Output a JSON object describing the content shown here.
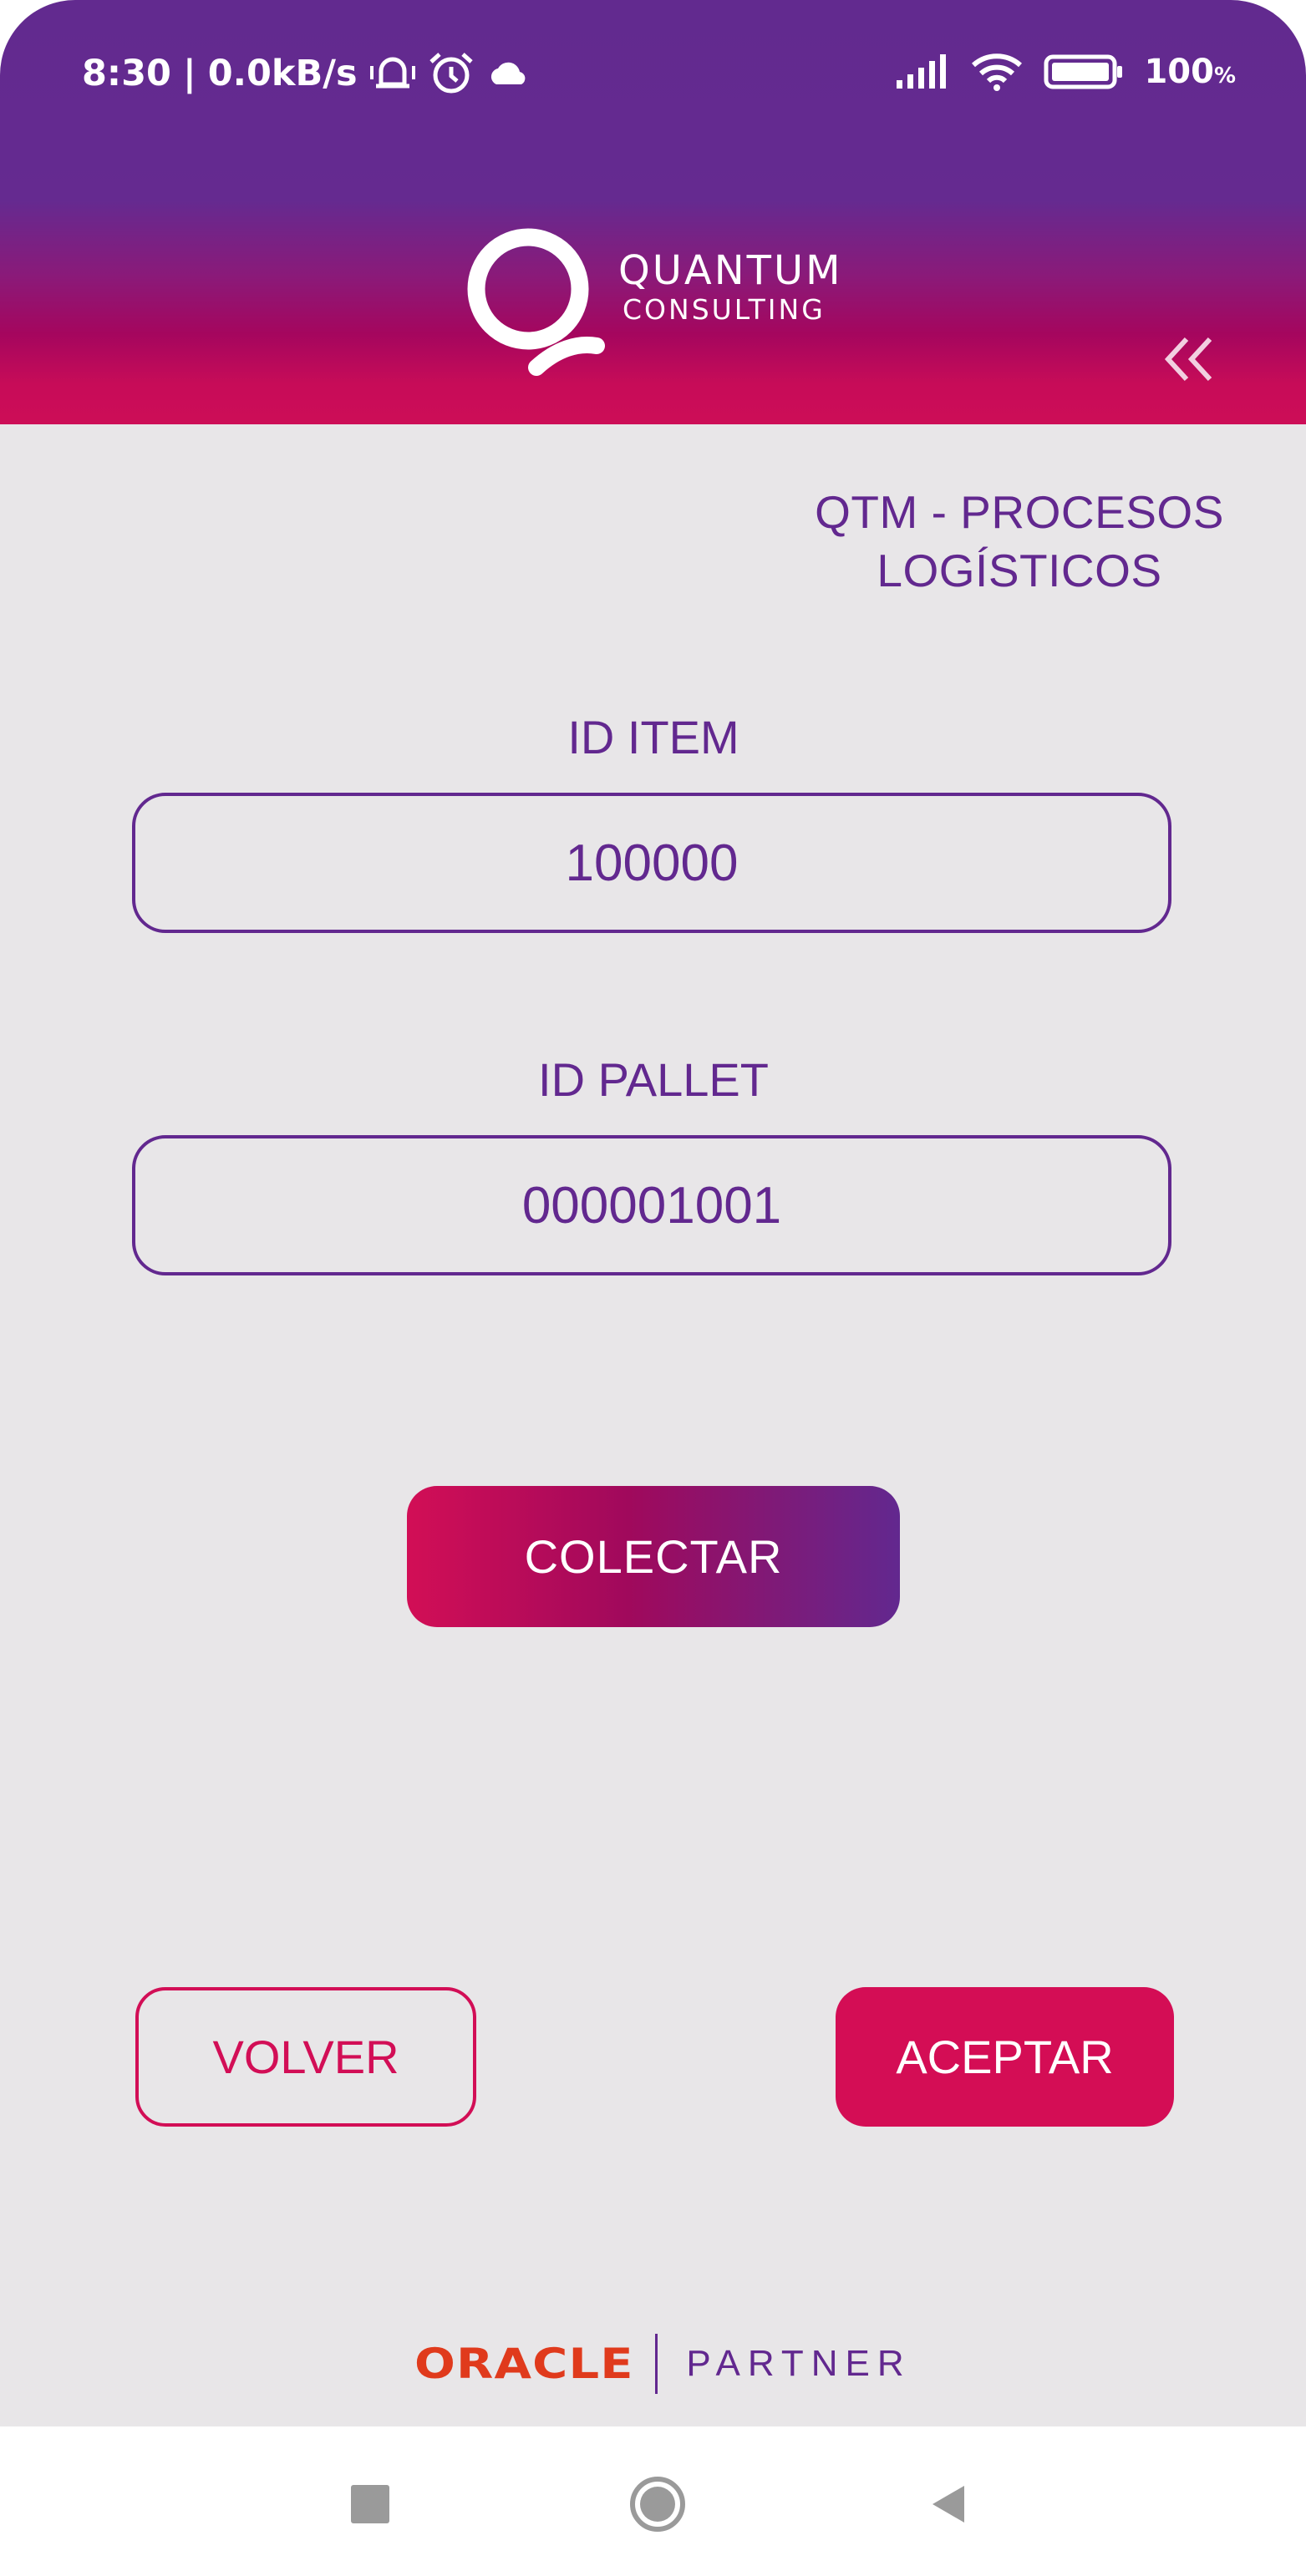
{
  "status_bar": {
    "time": "8:30",
    "separator": "|",
    "speed": "0.0kB/s",
    "battery_pct": "100",
    "battery_unit": "%",
    "icons": [
      "notification-bell-icon",
      "alarm-icon",
      "cloud-icon",
      "signal-icon",
      "wifi-icon",
      "battery-icon"
    ]
  },
  "header": {
    "logo_line1": "QUANTUM",
    "logo_line2": "CONSULTING",
    "back_icon": "double-chevron-left-icon"
  },
  "app": {
    "title_line1": "QTM - PROCESOS",
    "title_line2": "LOGÍSTICOS"
  },
  "form": {
    "item_label": "ID ITEM",
    "item_value": "100000",
    "pallet_label": "ID PALLET",
    "pallet_value": "000001001"
  },
  "actions": {
    "collect": "COLECTAR",
    "back": "VOLVER",
    "accept": "ACEPTAR"
  },
  "footer": {
    "brand": "ORACLE",
    "partner": "PARTNER"
  },
  "colors": {
    "primary_purple": "#62288f",
    "accent_magenta": "#d20e56",
    "background": "#e8e6e8",
    "oracle_red": "#e03a1c"
  }
}
